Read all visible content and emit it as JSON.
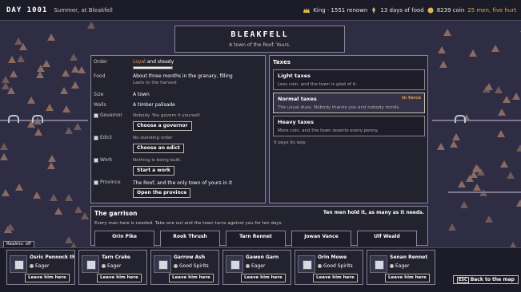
{
  "topbar": {
    "day": "DAY 1001",
    "season": "Summer, at Bleakfell",
    "renown": "King · 1551 renown",
    "food": "13 days of food",
    "coin": "8239 coin",
    "men": "25 men, five hurt",
    "colors": {
      "warning": "#e8a050"
    }
  },
  "banner": {
    "title": "BLEAKFELL",
    "subtitle": "A town of the Roof. Yours."
  },
  "details": {
    "order_label": "Order",
    "order_value": "Loyal",
    "order_value_rest": "and steady",
    "order_level": 0.95,
    "food_label": "Food",
    "food_value": "About three months in the granary, filling",
    "food_sub": "Lasts to the harvest",
    "size_label": "Size",
    "size_value": "A town",
    "walls_label": "Walls",
    "walls_value": "A timber palisade",
    "governor_label": "Governor",
    "governor_value": "Nobody. You govern it yourself.",
    "governor_button": "Choose a governor",
    "edict_label": "Edict",
    "edict_value": "No standing order",
    "edict_button": "Choose an edict",
    "work_label": "Work",
    "work_value": "Nothing is being built.",
    "work_button": "Start a work",
    "province_label": "Province",
    "province_value": "The Roof, and the only town of yours in it",
    "province_button": "Open the province"
  },
  "taxes": {
    "title": "Taxes",
    "options": [
      {
        "name": "Light taxes",
        "desc": "Less coin, and the town is glad of it.",
        "flag": ""
      },
      {
        "name": "Normal taxes",
        "desc": "The usual dues. Nobody thanks you and nobody minds.",
        "flag": "In force"
      },
      {
        "name": "Heavy taxes",
        "desc": "More coin, and the town resents every penny.",
        "flag": ""
      }
    ],
    "note": "It pays its way."
  },
  "garrison": {
    "title": "The garrison",
    "summary": "Ten men hold it, as many as it needs.",
    "desc": "Every man here is needed. Take one out and the town turns against you for ten days.",
    "slots": [
      "Orin Pike",
      "Rook Thrush",
      "Tarn Rennet",
      "Jowan Vance",
      "Ulf Weald"
    ]
  },
  "realms_toggle": "Realms: off",
  "roster": [
    {
      "name": "Osric Pennock th...",
      "mood": "Eager",
      "action": "Leave him here"
    },
    {
      "name": "Tarn Crake",
      "mood": "Eager",
      "action": "Leave him here"
    },
    {
      "name": "Garrow Ash",
      "mood": "Good Spirits",
      "action": "Leave him here"
    },
    {
      "name": "Gawen Garn",
      "mood": "Eager",
      "action": "Leave him here"
    },
    {
      "name": "Orin Mowe",
      "mood": "Good Spirits",
      "action": "Leave him here"
    },
    {
      "name": "Senan Rennet",
      "mood": "Eager",
      "action": "Leave him here"
    }
  ],
  "back": {
    "key": "ESC",
    "label": "Back to the map"
  }
}
